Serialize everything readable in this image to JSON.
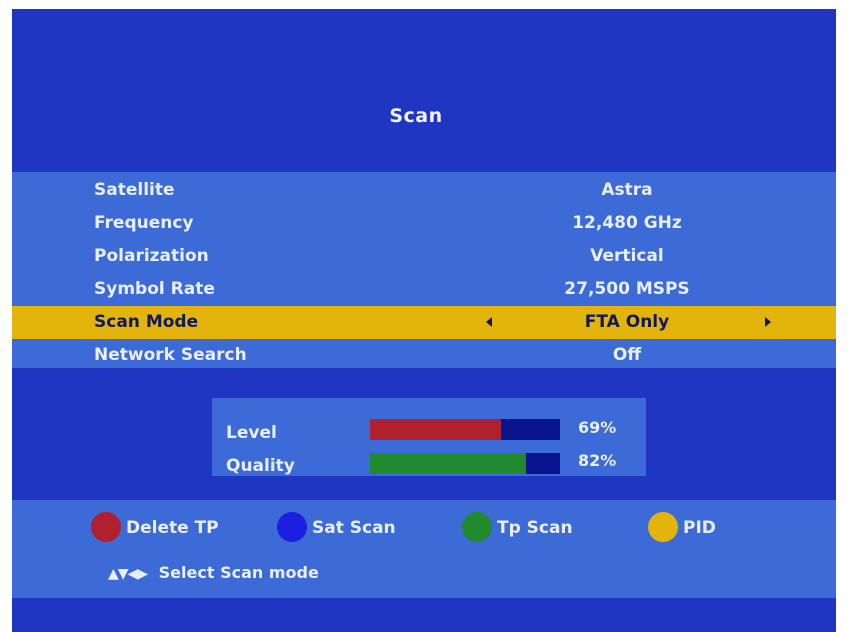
{
  "title": "Scan",
  "menu": [
    {
      "label": "Satellite",
      "value": "Astra",
      "selected": false
    },
    {
      "label": "Frequency",
      "value": "12,480 GHz",
      "selected": false
    },
    {
      "label": "Polarization",
      "value": "Vertical",
      "selected": false
    },
    {
      "label": "Symbol Rate",
      "value": "27,500 MSPS",
      "selected": false
    },
    {
      "label": "Scan Mode",
      "value": "FTA Only",
      "selected": true
    },
    {
      "label": "Network Search",
      "value": "Off",
      "selected": false
    }
  ],
  "signal": {
    "level": {
      "label": "Level",
      "percent": 69,
      "percent_text": "69%",
      "color": "#b0202e"
    },
    "quality": {
      "label": "Quality",
      "percent": 82,
      "percent_text": "82%",
      "color": "#1f8a2e"
    }
  },
  "footer": {
    "keys": [
      {
        "label": "Delete TP",
        "color": "#b0202e",
        "icon": "red-key-icon"
      },
      {
        "label": "Sat Scan",
        "color": "#1e1ee0",
        "icon": "blue-key-icon"
      },
      {
        "label": "Tp Scan",
        "color": "#1f8a2e",
        "icon": "green-key-icon"
      },
      {
        "label": "PID",
        "color": "#e3b40b",
        "icon": "yellow-key-icon"
      }
    ],
    "hint_nav": "▲▼◀▶",
    "hint_text": "Select Scan mode"
  },
  "colors": {
    "background": "#1e36c2",
    "panel": "#3c6ad6",
    "highlight": "#e3b40b",
    "bar_track": "#08148e"
  }
}
